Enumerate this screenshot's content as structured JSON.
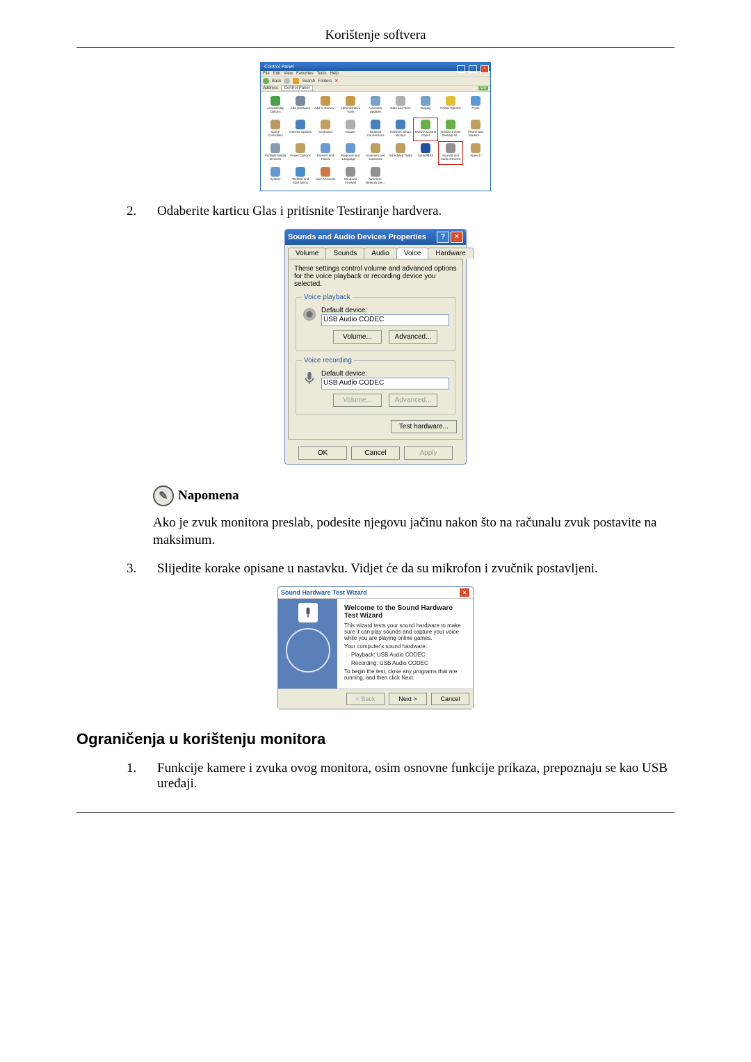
{
  "header": {
    "title": "Korištenje softvera"
  },
  "controlPanel": {
    "windowTitle": "Control Panel",
    "menu": [
      "File",
      "Edit",
      "View",
      "Favorites",
      "Tools",
      "Help"
    ],
    "toolbar": {
      "back": "Back",
      "search": "Search",
      "folders": "Folders"
    },
    "address": {
      "label": "Address",
      "value": "Control Panel",
      "go": "Go"
    },
    "items": [
      {
        "label": "Accessibility Options",
        "color": "#4aa04a"
      },
      {
        "label": "Add Hardware",
        "color": "#7a8aa0"
      },
      {
        "label": "Add or Remov...",
        "color": "#c79a49"
      },
      {
        "label": "Administrative Tools",
        "color": "#c79a49"
      },
      {
        "label": "Automatic Updates",
        "color": "#7aa0c7"
      },
      {
        "label": "Date and Time",
        "color": "#b0b0b0"
      },
      {
        "label": "Display",
        "color": "#7aa0c7"
      },
      {
        "label": "Folder Options",
        "color": "#e0c038"
      },
      {
        "label": "Fonts",
        "color": "#5a9ad6"
      },
      {
        "label": "Game Controllers",
        "color": "#b89a6a"
      },
      {
        "label": "Internet Options",
        "color": "#4a80c0"
      },
      {
        "label": "Keyboard",
        "color": "#c0a060"
      },
      {
        "label": "Mouse",
        "color": "#b0b0b0"
      },
      {
        "label": "Network Connections",
        "color": "#4a80c0"
      },
      {
        "label": "Network Setup Wizard",
        "color": "#4a80c0"
      },
      {
        "label": "NVIDIA Control Panel",
        "color": "#6ab04a",
        "hl": true
      },
      {
        "label": "NVIDIA nView Desktop M...",
        "color": "#6ab04a"
      },
      {
        "label": "Phone and Modem ...",
        "color": "#c0a060"
      },
      {
        "label": "Portable Media Devices",
        "color": "#8a9ab0"
      },
      {
        "label": "Power Options",
        "color": "#c0a060"
      },
      {
        "label": "Printers and Faxes",
        "color": "#6a9ad0"
      },
      {
        "label": "Regional and Language ...",
        "color": "#6a9ad0"
      },
      {
        "label": "Scanners and Cameras",
        "color": "#c0a060"
      },
      {
        "label": "Scheduled Tasks",
        "color": "#c0a060"
      },
      {
        "label": "SoundMAX",
        "color": "#2050a0"
      },
      {
        "label": "Sounds and Audio Devices",
        "color": "#909090",
        "hl": true
      },
      {
        "label": "Speech",
        "color": "#c0a060"
      },
      {
        "label": "System",
        "color": "#6a9ad0"
      },
      {
        "label": "Taskbar and Start Menu",
        "color": "#4a90d0"
      },
      {
        "label": "User Accounts",
        "color": "#d07a4a"
      },
      {
        "label": "Windows Firewall",
        "color": "#909090"
      },
      {
        "label": "Wireless Network Set...",
        "color": "#909090"
      }
    ]
  },
  "step2": {
    "num": "2.",
    "text": "Odaberite karticu Glas i pritisnite Testiranje hardvera."
  },
  "soundsDialog": {
    "title": "Sounds and Audio Devices Properties",
    "tabs": [
      "Volume",
      "Sounds",
      "Audio",
      "Voice",
      "Hardware"
    ],
    "activeTabIndex": 3,
    "desc": "These settings control volume and advanced options for the voice playback or recording device you selected.",
    "playback": {
      "legend": "Voice playback",
      "label": "Default device:",
      "value": "USB Audio CODEC",
      "volumeBtn": "Volume...",
      "advancedBtn": "Advanced..."
    },
    "recording": {
      "legend": "Voice recording",
      "label": "Default device:",
      "value": "USB Audio CODEC",
      "volumeBtn": "Volume...",
      "advancedBtn": "Advanced..."
    },
    "testBtn": "Test hardware...",
    "ok": "OK",
    "cancel": "Cancel",
    "apply": "Apply"
  },
  "note": {
    "heading": "Napomena",
    "text": "Ako je zvuk monitora preslab, podesite njegovu jačinu nakon što na računalu zvuk postavite na maksimum."
  },
  "step3": {
    "num": "3.",
    "text": "Slijedite korake opisane u nastavku. Vidjet će da su mikrofon i zvučnik postavljeni."
  },
  "wizard": {
    "title": "Sound Hardware Test Wizard",
    "heading": "Welcome to the Sound Hardware Test Wizard",
    "p1": "This wizard tests your sound hardware to make sure it can play sounds and capture your voice while you are playing online games.",
    "p2": "Your computer's sound hardware:",
    "playbackLine": "Playback: USB Audio CODEC",
    "recordingLine": "Recording: USB Audio CODEC",
    "p3": "To begin the test, close any programs that are running, and then click Next.",
    "back": "< Back",
    "next": "Next >",
    "cancel": "Cancel"
  },
  "h2": "Ograničenja u korištenju monitora",
  "item1": {
    "num": "1.",
    "text": "Funkcije kamere i zvuka ovog monitora, osim osnovne funkcije prikaza, prepoznaju se kao USB uređaji."
  }
}
